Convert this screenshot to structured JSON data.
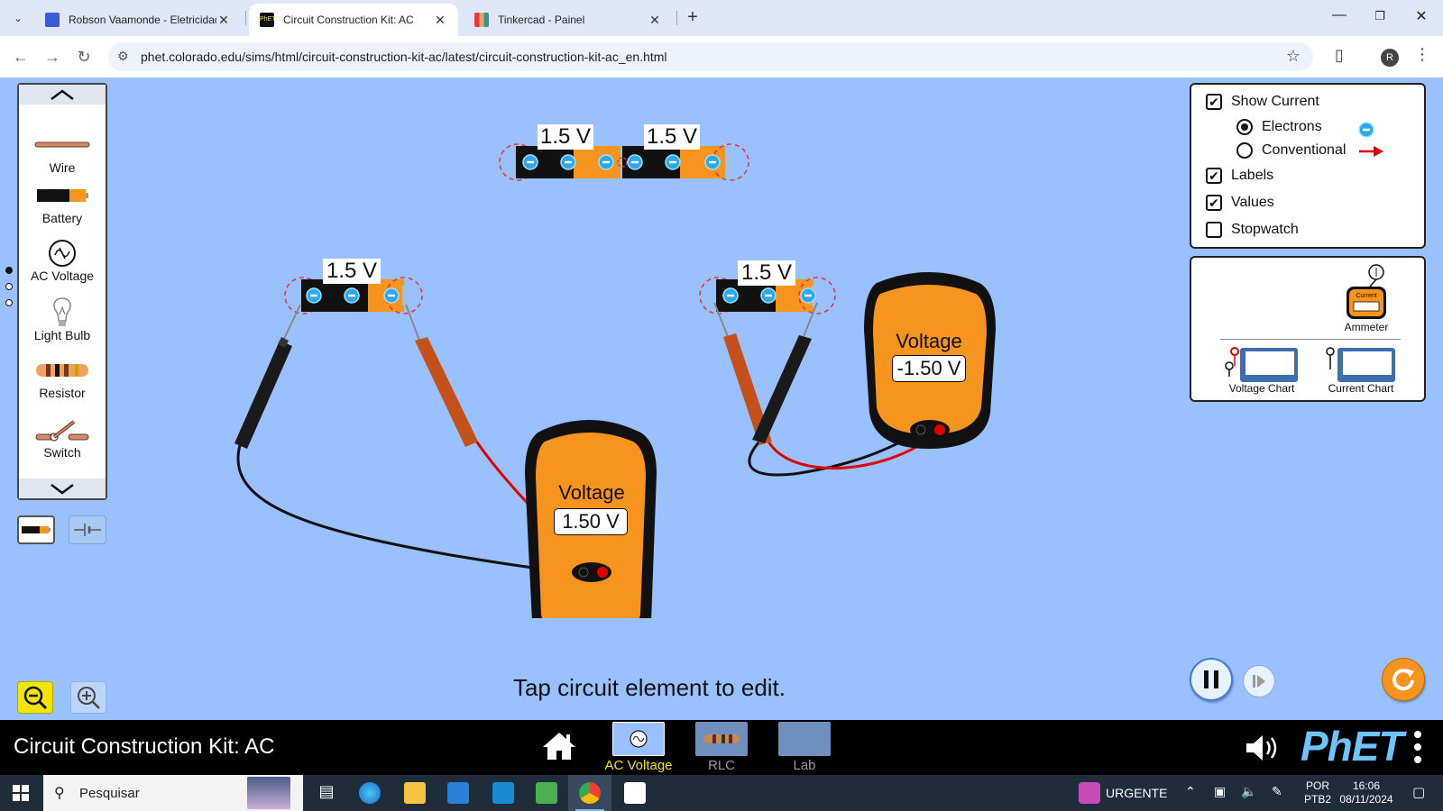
{
  "browser": {
    "tabs": [
      {
        "title": "Robson Vaamonde - Eletricidad",
        "active": false
      },
      {
        "title": "Circuit Construction Kit: AC",
        "active": true
      },
      {
        "title": "Tinkercad - Painel",
        "active": false
      }
    ],
    "url": "phet.colorado.edu/sims/html/circuit-construction-kit-ac/latest/circuit-construction-kit-ac_en.html",
    "profile_initial": "R"
  },
  "carousel": {
    "items": [
      {
        "label": "Wire",
        "icon": "wire-icon"
      },
      {
        "label": "Battery",
        "icon": "battery-icon"
      },
      {
        "label": "AC Voltage",
        "icon": "ac-source-icon"
      },
      {
        "label": "Light Bulb",
        "icon": "light-bulb-icon"
      },
      {
        "label": "Resistor",
        "icon": "resistor-icon"
      },
      {
        "label": "Switch",
        "icon": "switch-icon"
      }
    ]
  },
  "controls": {
    "show_current": {
      "label": "Show Current",
      "checked": true
    },
    "electrons": {
      "label": "Electrons",
      "selected": true
    },
    "conventional": {
      "label": "Conventional",
      "selected": false
    },
    "labels": {
      "label": "Labels",
      "checked": true
    },
    "values": {
      "label": "Values",
      "checked": true
    },
    "stopwatch": {
      "label": "Stopwatch",
      "checked": false
    }
  },
  "toolbox": {
    "ammeter": "Ammeter",
    "ammeter_device_label": "Current",
    "voltage_chart": "Voltage Chart",
    "current_chart": "Current Chart"
  },
  "circuit": {
    "battery_labels": [
      "1.5 V",
      "1.5 V",
      "1.5 V",
      "1.5 V"
    ],
    "voltmeter_1": {
      "title": "Voltage",
      "reading": "1.50 V"
    },
    "voltmeter_2": {
      "title": "Voltage",
      "reading": "-1.50 V"
    }
  },
  "hint": "Tap circuit element to edit.",
  "navbar": {
    "title": "Circuit Construction Kit: AC",
    "screens": [
      {
        "label": "AC Voltage",
        "selected": true
      },
      {
        "label": "RLC",
        "selected": false
      },
      {
        "label": "Lab",
        "selected": false
      }
    ],
    "logo": "PhET"
  },
  "taskbar": {
    "search_placeholder": "Pesquisar",
    "urgente": "URGENTE",
    "lang_1": "POR",
    "lang_2": "PTB2",
    "time": "16:06",
    "date": "08/11/2024"
  },
  "colors": {
    "sim_background": "#99c1ff",
    "meter_orange": "#f7941d",
    "wire_red": "#e00000",
    "electron_blue": "#2ea8e6",
    "navbar_selected": "#f2e600"
  }
}
